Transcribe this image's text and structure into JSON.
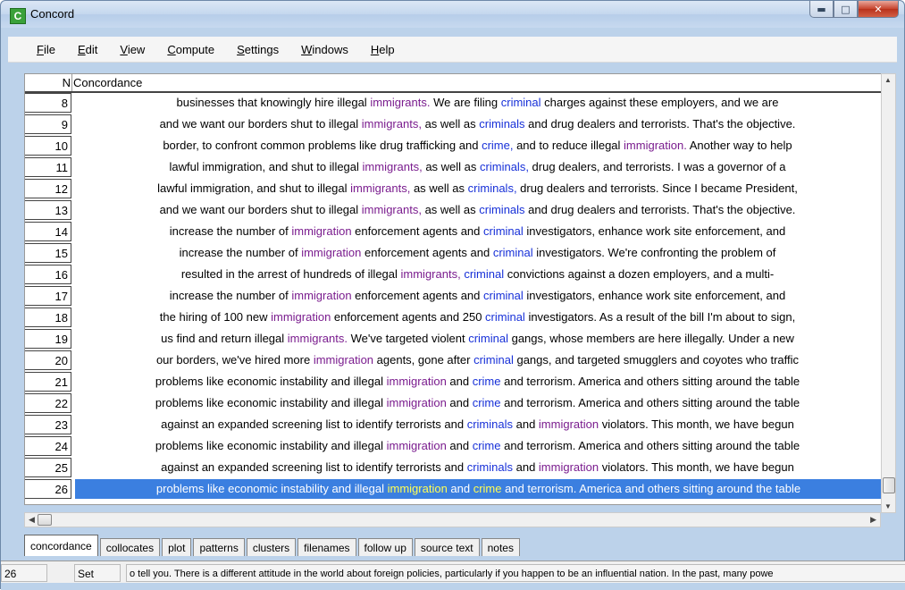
{
  "window": {
    "title": "Concord",
    "icon_letter": "C"
  },
  "menu": [
    {
      "label": "File",
      "underline": "F"
    },
    {
      "label": "Edit",
      "underline": "E"
    },
    {
      "label": "View",
      "underline": "V"
    },
    {
      "label": "Compute",
      "underline": "C"
    },
    {
      "label": "Settings",
      "underline": "S"
    },
    {
      "label": "Windows",
      "underline": "W"
    },
    {
      "label": "Help",
      "underline": "H"
    }
  ],
  "grid": {
    "header_n": "N",
    "header_concordance": "Concordance",
    "selected_row": "26",
    "rows": [
      {
        "n": "8",
        "segments": [
          {
            "t": "businesses that knowingly hire illegal "
          },
          {
            "t": "immigrants.",
            "c": "h"
          },
          {
            "t": " We are filing "
          },
          {
            "t": "criminal",
            "c": "c"
          },
          {
            "t": " charges against these employers, and we are"
          }
        ]
      },
      {
        "n": "9",
        "segments": [
          {
            "t": "and we want our borders shut to illegal "
          },
          {
            "t": "immigrants,",
            "c": "h"
          },
          {
            "t": " as well as "
          },
          {
            "t": "criminals",
            "c": "c"
          },
          {
            "t": " and drug dealers and terrorists. That's the objective."
          }
        ]
      },
      {
        "n": "10",
        "segments": [
          {
            "t": "border, to confront common problems like drug trafficking and "
          },
          {
            "t": "crime,",
            "c": "c"
          },
          {
            "t": " and to reduce illegal "
          },
          {
            "t": "immigration.",
            "c": "h"
          },
          {
            "t": " Another way to help"
          }
        ]
      },
      {
        "n": "11",
        "segments": [
          {
            "t": "lawful immigration, and shut to illegal "
          },
          {
            "t": "immigrants,",
            "c": "h"
          },
          {
            "t": " as well as "
          },
          {
            "t": "criminals,",
            "c": "c"
          },
          {
            "t": " drug dealers, and terrorists. I was a governor of a"
          }
        ]
      },
      {
        "n": "12",
        "segments": [
          {
            "t": "lawful immigration, and shut to illegal "
          },
          {
            "t": "immigrants,",
            "c": "h"
          },
          {
            "t": " as well as "
          },
          {
            "t": "criminals,",
            "c": "c"
          },
          {
            "t": " drug dealers and terrorists. Since I became President,"
          }
        ]
      },
      {
        "n": "13",
        "segments": [
          {
            "t": "and we want our borders shut to illegal "
          },
          {
            "t": "immigrants,",
            "c": "h"
          },
          {
            "t": " as well as "
          },
          {
            "t": "criminals",
            "c": "c"
          },
          {
            "t": " and drug dealers and terrorists. That's the objective."
          }
        ]
      },
      {
        "n": "14",
        "segments": [
          {
            "t": "increase the number of "
          },
          {
            "t": "immigration",
            "c": "h"
          },
          {
            "t": " enforcement agents and "
          },
          {
            "t": "criminal",
            "c": "c"
          },
          {
            "t": " investigators, enhance work site enforcement, and"
          }
        ]
      },
      {
        "n": "15",
        "segments": [
          {
            "t": "increase the number of "
          },
          {
            "t": "immigration",
            "c": "h"
          },
          {
            "t": " enforcement agents and "
          },
          {
            "t": "criminal",
            "c": "c"
          },
          {
            "t": " investigators. We're confronting the problem of"
          }
        ]
      },
      {
        "n": "16",
        "segments": [
          {
            "t": "resulted in the arrest of hundreds of illegal "
          },
          {
            "t": "immigrants,",
            "c": "h"
          },
          {
            "t": " "
          },
          {
            "t": "criminal",
            "c": "c"
          },
          {
            "t": " convictions against a dozen employers, and a multi-"
          }
        ]
      },
      {
        "n": "17",
        "segments": [
          {
            "t": "increase the number of "
          },
          {
            "t": "immigration",
            "c": "h"
          },
          {
            "t": " enforcement agents and "
          },
          {
            "t": "criminal",
            "c": "c"
          },
          {
            "t": " investigators, enhance work site enforcement, and"
          }
        ]
      },
      {
        "n": "18",
        "segments": [
          {
            "t": "the hiring of 100 new "
          },
          {
            "t": "immigration",
            "c": "h"
          },
          {
            "t": " enforcement agents and 250 "
          },
          {
            "t": "criminal",
            "c": "c"
          },
          {
            "t": " investigators. As a result of the bill I'm about to sign,"
          }
        ]
      },
      {
        "n": "19",
        "segments": [
          {
            "t": "us find and return illegal "
          },
          {
            "t": "immigrants.",
            "c": "h"
          },
          {
            "t": " We've targeted violent "
          },
          {
            "t": "criminal",
            "c": "c"
          },
          {
            "t": " gangs, whose members are here illegally. Under a new"
          }
        ]
      },
      {
        "n": "20",
        "segments": [
          {
            "t": "our borders, we've hired more "
          },
          {
            "t": "immigration",
            "c": "h"
          },
          {
            "t": " agents, gone after "
          },
          {
            "t": "criminal",
            "c": "c"
          },
          {
            "t": " gangs, and targeted smugglers and coyotes who traffic"
          }
        ]
      },
      {
        "n": "21",
        "segments": [
          {
            "t": "problems like economic instability and illegal "
          },
          {
            "t": "immigration",
            "c": "h"
          },
          {
            "t": " and "
          },
          {
            "t": "crime",
            "c": "c"
          },
          {
            "t": " and terrorism. America and others sitting around the table"
          }
        ]
      },
      {
        "n": "22",
        "segments": [
          {
            "t": "problems like economic instability and illegal "
          },
          {
            "t": "immigration",
            "c": "h"
          },
          {
            "t": " and "
          },
          {
            "t": "crime",
            "c": "c"
          },
          {
            "t": " and terrorism. America and others sitting around the table"
          }
        ]
      },
      {
        "n": "23",
        "segments": [
          {
            "t": "against an expanded screening list to identify terrorists and "
          },
          {
            "t": "criminals",
            "c": "c"
          },
          {
            "t": " and "
          },
          {
            "t": "immigration",
            "c": "h"
          },
          {
            "t": " violators. This month, we have begun"
          }
        ]
      },
      {
        "n": "24",
        "segments": [
          {
            "t": "problems like economic instability and illegal "
          },
          {
            "t": "immigration",
            "c": "h"
          },
          {
            "t": " and "
          },
          {
            "t": "crime",
            "c": "c"
          },
          {
            "t": " and terrorism. America and others sitting around the table"
          }
        ]
      },
      {
        "n": "25",
        "segments": [
          {
            "t": "against an expanded screening list to identify terrorists and "
          },
          {
            "t": "criminals",
            "c": "c"
          },
          {
            "t": " and "
          },
          {
            "t": "immigration",
            "c": "h"
          },
          {
            "t": " violators. This month, we have begun"
          }
        ]
      },
      {
        "n": "26",
        "segments": [
          {
            "t": "problems like economic instability and illegal "
          },
          {
            "t": "immigration",
            "c": "h"
          },
          {
            "t": " and "
          },
          {
            "t": "crime",
            "c": "c"
          },
          {
            "t": " and terrorism. America and others sitting around the table"
          }
        ]
      }
    ]
  },
  "tabs": [
    "concordance",
    "collocates",
    "plot",
    "patterns",
    "clusters",
    "filenames",
    "follow up",
    "source text",
    "notes"
  ],
  "active_tab": "concordance",
  "status": {
    "row": "26",
    "state": "Set",
    "text": "o tell you. There is a different attitude in the world about foreign policies, particularly if you happen to be an influential nation. In the past, many powe"
  },
  "colors": {
    "headword": "#7a1c8e",
    "collocate": "#1730d8",
    "selection": "#3b7fe0",
    "selection_text": "#ffff55"
  }
}
